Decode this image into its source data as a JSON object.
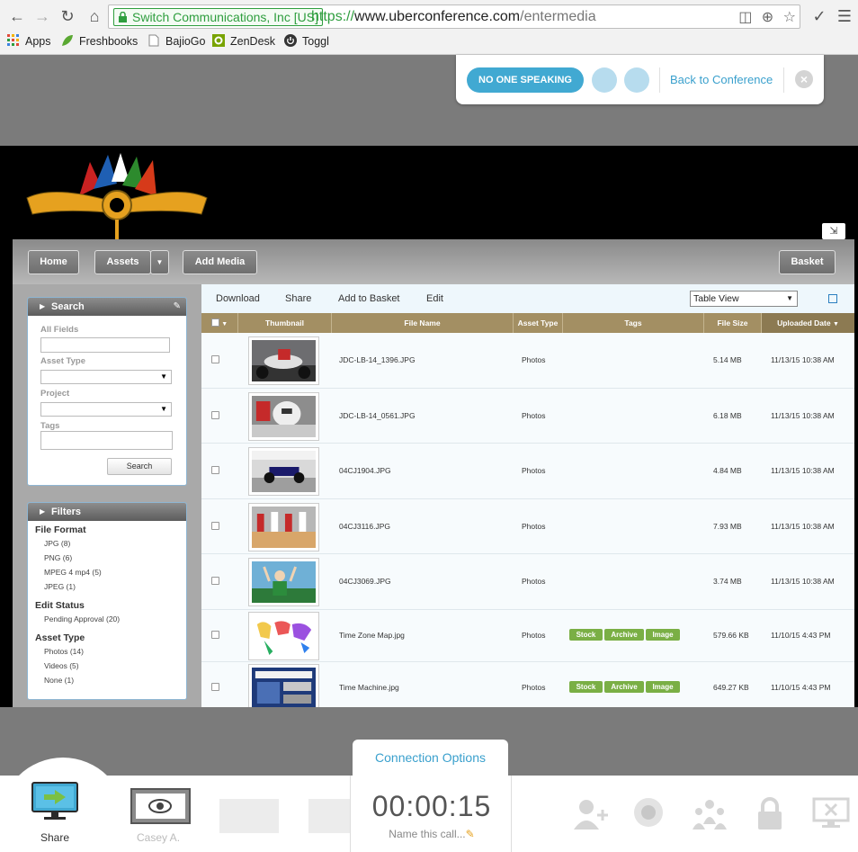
{
  "browser": {
    "ev_label": "Switch Communications, Inc [US]",
    "url_scheme": "https://",
    "url_host": "www.uberconference.com",
    "url_path": "/entermedia",
    "bookmarks": [
      "Apps",
      "Freshbooks",
      "BajioGo",
      "ZenDesk",
      "Toggl"
    ]
  },
  "conference": {
    "speaking_label": "NO ONE SPEAKING",
    "back_label": "Back to Conference"
  },
  "app": {
    "nav": {
      "home": "Home",
      "assets": "Assets",
      "add_media": "Add Media",
      "basket": "Basket"
    },
    "search_panel": {
      "title": "Search",
      "all_fields_label": "All Fields",
      "asset_type_label": "Asset Type",
      "project_label": "Project",
      "tags_label": "Tags",
      "search_button": "Search"
    },
    "filters_panel": {
      "title": "Filters",
      "groups": [
        {
          "title": "File Format",
          "items": [
            "JPG (8)",
            "PNG (6)",
            "MPEG 4 mp4 (5)",
            "JPEG (1)"
          ]
        },
        {
          "title": "Edit Status",
          "items": [
            "Pending Approval (20)"
          ]
        },
        {
          "title": "Asset Type",
          "items": [
            "Photos (14)",
            "Videos (5)",
            "None (1)"
          ]
        }
      ]
    },
    "actions": {
      "download": "Download",
      "share": "Share",
      "add_to_basket": "Add to Basket",
      "edit": "Edit",
      "view_select": "Table View"
    },
    "columns": [
      "Thumbnail",
      "File Name",
      "Asset Type",
      "Tags",
      "File Size",
      "Uploaded Date"
    ],
    "rows": [
      {
        "file_name": "JDC-LB-14_1396.JPG",
        "asset_type": "Photos",
        "tags": [],
        "file_size": "5.14 MB",
        "uploaded": "11/13/15 10:38 AM"
      },
      {
        "file_name": "JDC-LB-14_0561.JPG",
        "asset_type": "Photos",
        "tags": [],
        "file_size": "6.18 MB",
        "uploaded": "11/13/15 10:38 AM"
      },
      {
        "file_name": "04CJ1904.JPG",
        "asset_type": "Photos",
        "tags": [],
        "file_size": "4.84 MB",
        "uploaded": "11/13/15 10:38 AM"
      },
      {
        "file_name": "04CJ3116.JPG",
        "asset_type": "Photos",
        "tags": [],
        "file_size": "7.93 MB",
        "uploaded": "11/13/15 10:38 AM"
      },
      {
        "file_name": "04CJ3069.JPG",
        "asset_type": "Photos",
        "tags": [],
        "file_size": "3.74 MB",
        "uploaded": "11/13/15 10:38 AM"
      },
      {
        "file_name": "Time Zone Map.jpg",
        "asset_type": "Photos",
        "tags": [
          "Stock",
          "Archive",
          "Image"
        ],
        "file_size": "579.66 KB",
        "uploaded": "11/10/15 4:43 PM"
      },
      {
        "file_name": "Time Machine.jpg",
        "asset_type": "Photos",
        "tags": [
          "Stock",
          "Archive",
          "Image"
        ],
        "file_size": "649.27 KB",
        "uploaded": "11/10/15 4:43 PM"
      }
    ]
  },
  "dock": {
    "connection_options": "Connection Options",
    "share_label": "Share",
    "casey_label": "Casey A.",
    "timer": "00:00:15",
    "name_call": "Name this call..."
  },
  "colors": {
    "accent_blue": "#41a9d2",
    "table_header": "#a38f63",
    "tag_green": "#7aaf45"
  }
}
